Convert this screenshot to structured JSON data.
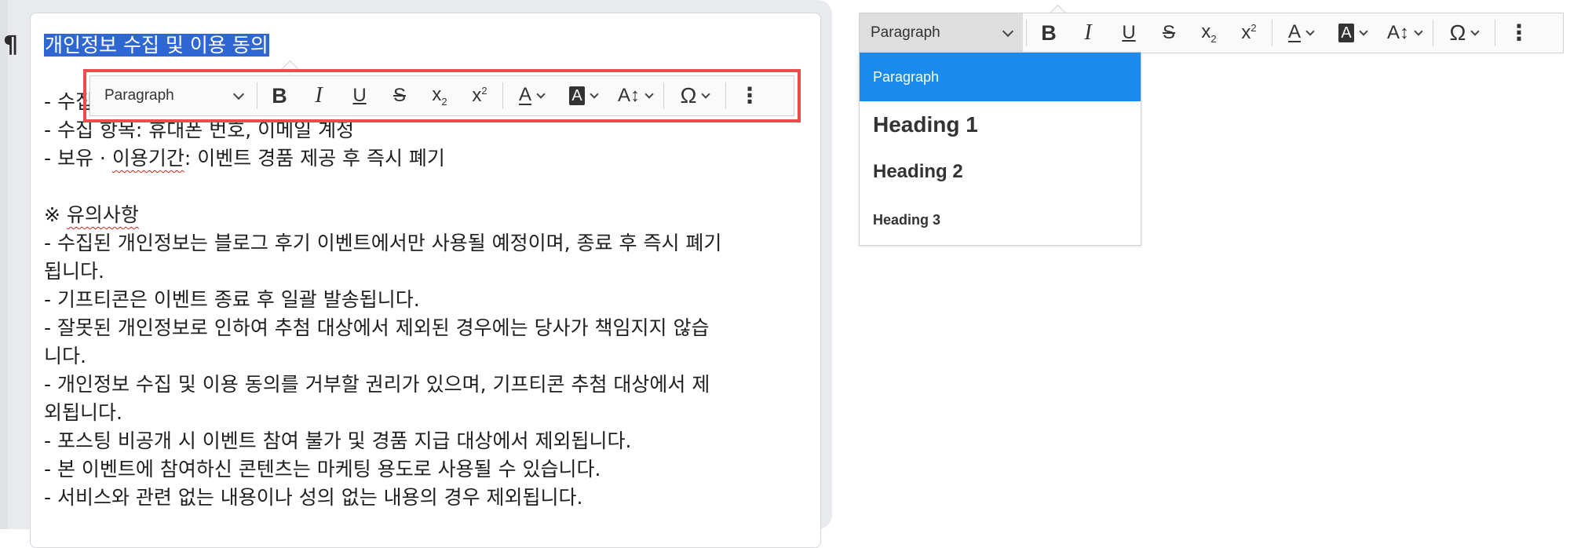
{
  "editor": {
    "pilcrow": "¶",
    "title": "개인정보 수집 및 이용 동의",
    "lines": [
      {
        "text": "- 수집 목적: 이벤트 경품 제공"
      },
      {
        "text": "- 수집 항목: 휴대폰 번호, 이메일 계정"
      },
      {
        "prefix": "- 보유 · ",
        "spell": "이용기간",
        "suffix": ": 이벤트 경품 제공 후 즉시 폐기"
      }
    ],
    "notice_prefix": "※ ",
    "notice_heading": "유의사항",
    "notice_lines": [
      "- 수집된 개인정보는 블로그 후기 이벤트에서만 사용될 예정이며, 종료 후 즉시 폐기",
      "됩니다.",
      "- 기프티콘은 이벤트 종료 후 일괄 발송됩니다.",
      "- 잘못된 개인정보로 인하여 추첨 대상에서 제외된 경우에는 당사가 책임지지 않습",
      "니다.",
      "- 개인정보 수집 및 이용 동의를 거부할 권리가 있으며, 기프티콘 추첨 대상에서 제",
      "외됩니다.",
      "- 포스팅 비공개 시 이벤트 참여 불가 및 경품 지급 대상에서 제외됩니다.",
      "- 본 이벤트에 참여하신 콘텐츠는 마케팅 용도로 사용될 수 있습니다.",
      "- 서비스와 관련 없는 내용이나 성의 없는 내용의 경우 제외됩니다."
    ]
  },
  "toolbar": {
    "block_format": "Paragraph",
    "buttons": {
      "bold": "B",
      "italic": "I",
      "underline": "U",
      "strike": "S",
      "subscript": "x",
      "subscript_mark": "2",
      "superscript": "x",
      "superscript_mark": "2",
      "font_color": "A",
      "bg_color": "A",
      "font_size": "A↕",
      "special_char": "Ω",
      "more": "⋮"
    }
  },
  "dropdown": {
    "options": [
      {
        "label": "Paragraph",
        "selected": true
      },
      {
        "label": "Heading 1"
      },
      {
        "label": "Heading 2"
      },
      {
        "label": "Heading 3"
      }
    ]
  },
  "colors": {
    "selection": "#2f67d2",
    "highlight_border": "#f04a4f",
    "dropdown_active": "#1a8aec",
    "spellcheck": "#e02020"
  }
}
